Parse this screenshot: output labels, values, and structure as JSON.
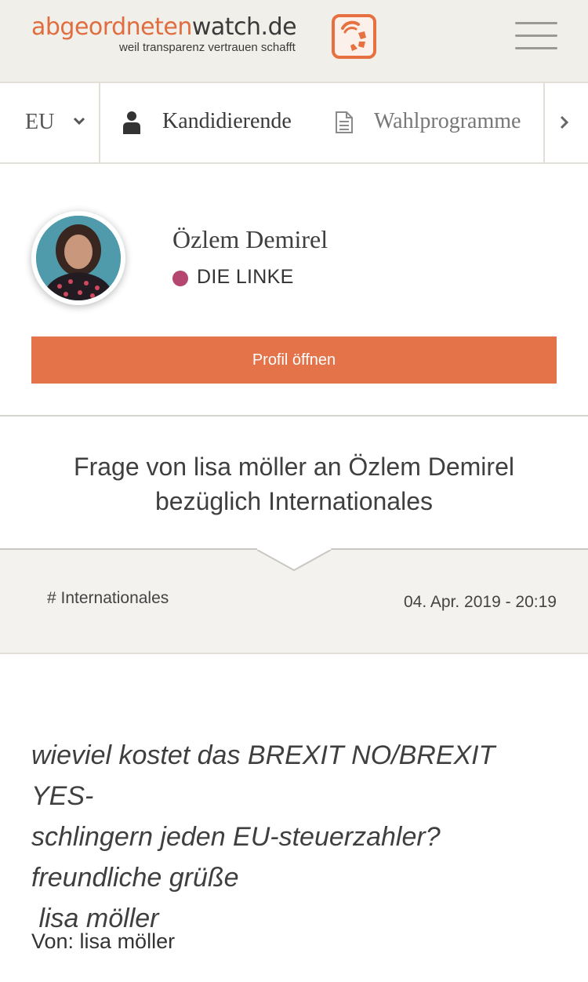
{
  "header": {
    "logo_part1": "abgeordneten",
    "logo_part2": "watch.de",
    "tagline": "weil transparenz vertrauen schafft",
    "accent_color": "#e06d3f",
    "menu_icon": "hamburger-menu-icon"
  },
  "nav": {
    "region": "EU",
    "items": [
      {
        "label": "Kandidierende",
        "icon": "person-icon"
      },
      {
        "label": "Wahlprogramme",
        "icon": "document-icon"
      }
    ],
    "scroll_icon": "chevron-right-icon"
  },
  "profile": {
    "name": "Özlem Demirel",
    "party": "DIE LINKE",
    "party_color": "#b5466f",
    "button_label": "Profil öffnen",
    "button_color": "#e5734a"
  },
  "question": {
    "title": "Frage von lisa möller an Özlem Demirel bezüglich Internationales",
    "tag": "# Internationales",
    "date": "04. Apr. 2019 - 20:19",
    "body_lines": [
      "wieviel kostet das BREXIT NO/BREXIT YES-",
      "schlingern jeden EU-steuerzahler?",
      "freundliche grüße",
      " lisa möller"
    ],
    "from": "Von: lisa möller"
  }
}
